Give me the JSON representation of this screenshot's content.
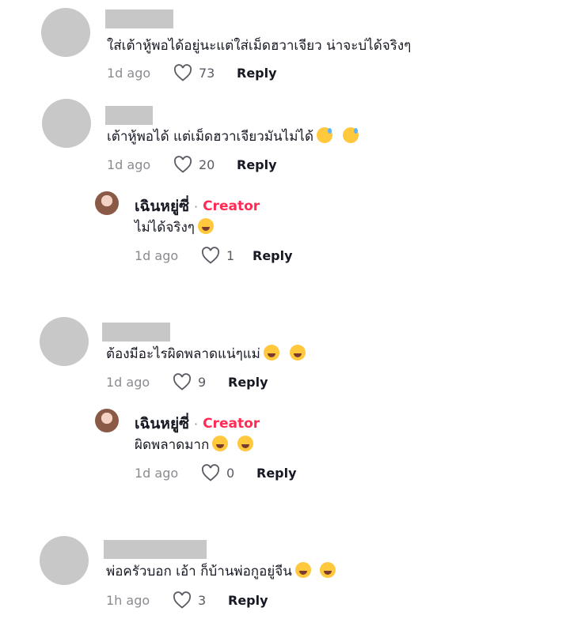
{
  "comments": [
    {
      "text": "ใส่เต้าหู้พอได้อยู่นะแต่ใส่เม็ดฮวาเจียว น่าจะบ่ได้จริงๆ",
      "time": "1d ago",
      "likes": "73",
      "reply_label": "Reply"
    },
    {
      "text": "เต้าหู้พอได้ แต่เม็ดฮวาเจียวมันไม่ได้",
      "time": "1d ago",
      "likes": "20",
      "reply_label": "Reply",
      "reply": {
        "name": "เฉินหยู่ซี่",
        "badge": "Creator",
        "text": "ไม่ได้จริงๆ",
        "time": "1d ago",
        "likes": "1",
        "reply_label": "Reply"
      }
    },
    {
      "text": "ต้องมีอะไรผิดพลาดแน่ๆแม่",
      "time": "1d ago",
      "likes": "9",
      "reply_label": "Reply",
      "reply": {
        "name": "เฉินหยู่ซี่",
        "badge": "Creator",
        "text": "ผิดพลาดมาก",
        "time": "1d ago",
        "likes": "0",
        "reply_label": "Reply"
      }
    },
    {
      "text": "พ่อครัวบอก เอ้า ก็บ้านพ่อกูอยู่จีน",
      "time": "1h ago",
      "likes": "3",
      "reply_label": "Reply"
    }
  ],
  "icons": {
    "like": "heart-outline-icon",
    "sweat_emoji": "grinning-sweat-emoji",
    "laugh_emoji": "tears-of-joy-emoji"
  },
  "colors": {
    "creator_accent": "#fe2c55",
    "meta_gray": "#8a8b91",
    "redaction": "#c7c7c7"
  }
}
